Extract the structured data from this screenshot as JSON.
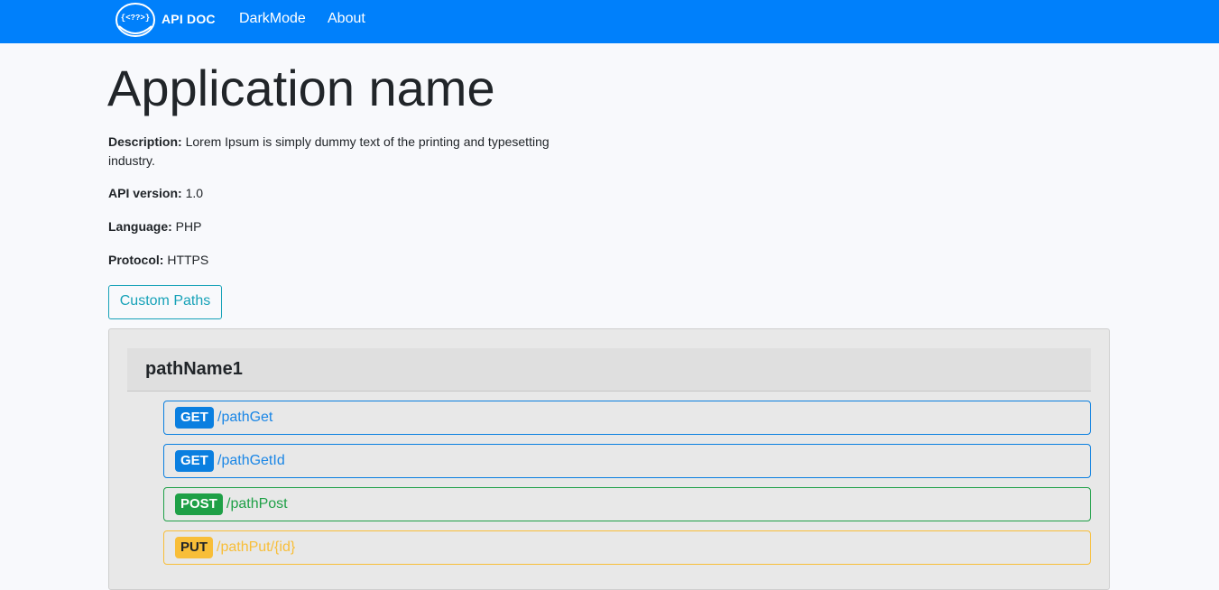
{
  "navbar": {
    "brand_icon_text": "{<??>}",
    "brand": "API DOC",
    "links": [
      {
        "label": "DarkMode"
      },
      {
        "label": "About"
      }
    ],
    "color": "#0080fb"
  },
  "main": {
    "title": "Application name",
    "info": {
      "description_label": "Description:",
      "description_value": "Lorem Ipsum is simply dummy text of the printing and typesetting industry.",
      "version_label": "API version:",
      "version_value": "1.0",
      "language_label": "Language:",
      "language_value": "PHP",
      "protocol_label": "Protocol:",
      "protocol_value": "HTTPS"
    },
    "custom_paths_button": "Custom Paths"
  },
  "paths": {
    "group_name": "pathName1",
    "endpoints": [
      {
        "method": "GET",
        "path": "/pathGet",
        "color": "#0a7fe0"
      },
      {
        "method": "GET",
        "path": "/pathGetId",
        "color": "#0a7fe0"
      },
      {
        "method": "POST",
        "path": "/pathPost",
        "color": "#1fa047"
      },
      {
        "method": "PUT",
        "path": "/pathPut/{id}",
        "color": "#f8be38"
      }
    ]
  }
}
